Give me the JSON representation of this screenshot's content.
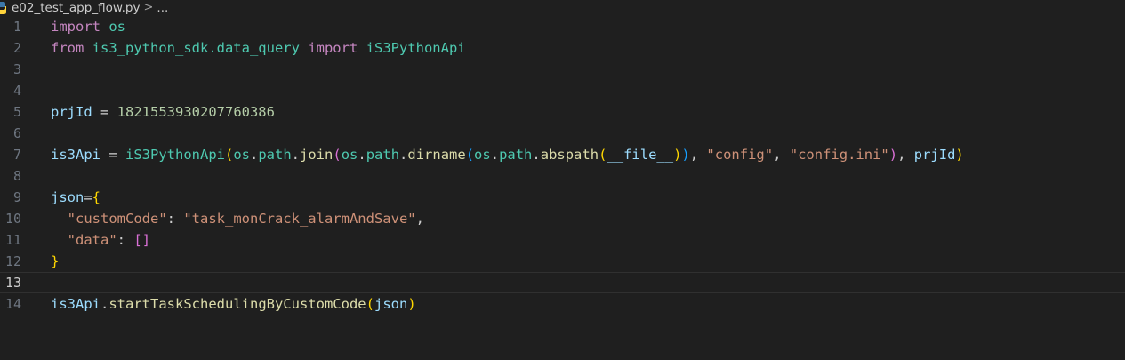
{
  "breadcrumb": {
    "file_name": "e02_test_app_flow.py",
    "separator": ">",
    "ellipsis": "..."
  },
  "editor": {
    "current_line": 13,
    "lines": [
      {
        "number": "1",
        "tokens": [
          {
            "t": "import",
            "c": "kw"
          },
          {
            "t": " "
          },
          {
            "t": "os",
            "c": "mod"
          }
        ]
      },
      {
        "number": "2",
        "tokens": [
          {
            "t": "from",
            "c": "kw"
          },
          {
            "t": " "
          },
          {
            "t": "is3_python_sdk.data_query",
            "c": "mod"
          },
          {
            "t": " "
          },
          {
            "t": "import",
            "c": "kw"
          },
          {
            "t": " "
          },
          {
            "t": "iS3PythonApi",
            "c": "cls"
          }
        ]
      },
      {
        "number": "3",
        "tokens": []
      },
      {
        "number": "4",
        "tokens": []
      },
      {
        "number": "5",
        "tokens": [
          {
            "t": "prjId",
            "c": "var"
          },
          {
            "t": " = ",
            "c": "op"
          },
          {
            "t": "1821553930207760386",
            "c": "num"
          }
        ]
      },
      {
        "number": "6",
        "tokens": []
      },
      {
        "number": "7",
        "tokens": [
          {
            "t": "is3Api",
            "c": "var"
          },
          {
            "t": " = ",
            "c": "op"
          },
          {
            "t": "iS3PythonApi",
            "c": "cls"
          },
          {
            "t": "(",
            "c": "b1"
          },
          {
            "t": "os",
            "c": "mod"
          },
          {
            "t": "."
          },
          {
            "t": "path",
            "c": "mod"
          },
          {
            "t": "."
          },
          {
            "t": "join",
            "c": "fn"
          },
          {
            "t": "(",
            "c": "b2"
          },
          {
            "t": "os",
            "c": "mod"
          },
          {
            "t": "."
          },
          {
            "t": "path",
            "c": "mod"
          },
          {
            "t": "."
          },
          {
            "t": "dirname",
            "c": "fn"
          },
          {
            "t": "(",
            "c": "b3"
          },
          {
            "t": "os",
            "c": "mod"
          },
          {
            "t": "."
          },
          {
            "t": "path",
            "c": "mod"
          },
          {
            "t": "."
          },
          {
            "t": "abspath",
            "c": "fn"
          },
          {
            "t": "(",
            "c": "b1"
          },
          {
            "t": "__file__",
            "c": "var"
          },
          {
            "t": ")",
            "c": "b1"
          },
          {
            "t": ")",
            "c": "b3"
          },
          {
            "t": ", "
          },
          {
            "t": "\"config\"",
            "c": "str"
          },
          {
            "t": ", "
          },
          {
            "t": "\"config.ini\"",
            "c": "str"
          },
          {
            "t": ")",
            "c": "b2"
          },
          {
            "t": ", "
          },
          {
            "t": "prjId",
            "c": "var"
          },
          {
            "t": ")",
            "c": "b1"
          }
        ]
      },
      {
        "number": "8",
        "tokens": []
      },
      {
        "number": "9",
        "tokens": [
          {
            "t": "json",
            "c": "var"
          },
          {
            "t": "=",
            "c": "op"
          },
          {
            "t": "{",
            "c": "b1"
          }
        ]
      },
      {
        "number": "10",
        "indent": true,
        "tokens": [
          {
            "t": "  "
          },
          {
            "t": "\"customCode\"",
            "c": "str"
          },
          {
            "t": ": "
          },
          {
            "t": "\"task_monCrack_alarmAndSave\"",
            "c": "str"
          },
          {
            "t": ","
          }
        ]
      },
      {
        "number": "11",
        "indent": true,
        "tokens": [
          {
            "t": "  "
          },
          {
            "t": "\"data\"",
            "c": "str"
          },
          {
            "t": ": "
          },
          {
            "t": "[",
            "c": "b2"
          },
          {
            "t": "]",
            "c": "b2"
          }
        ]
      },
      {
        "number": "12",
        "tokens": [
          {
            "t": "}",
            "c": "b1"
          }
        ]
      },
      {
        "number": "13",
        "tokens": []
      },
      {
        "number": "14",
        "tokens": [
          {
            "t": "is3Api",
            "c": "var"
          },
          {
            "t": "."
          },
          {
            "t": "startTaskSchedulingByCustomCode",
            "c": "fn"
          },
          {
            "t": "(",
            "c": "b1"
          },
          {
            "t": "json",
            "c": "var"
          },
          {
            "t": ")",
            "c": "b1"
          }
        ]
      }
    ]
  }
}
